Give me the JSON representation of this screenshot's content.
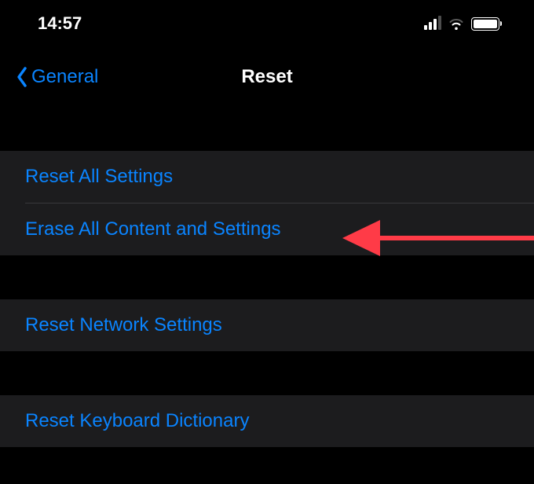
{
  "statusBar": {
    "time": "14:57"
  },
  "navBar": {
    "backLabel": "General",
    "title": "Reset"
  },
  "groups": [
    {
      "items": [
        {
          "label": "Reset All Settings"
        },
        {
          "label": "Erase All Content and Settings"
        }
      ]
    },
    {
      "items": [
        {
          "label": "Reset Network Settings"
        }
      ]
    },
    {
      "items": [
        {
          "label": "Reset Keyboard Dictionary"
        }
      ]
    }
  ],
  "colors": {
    "accent": "#0a84ff",
    "annotationArrow": "#ff3b47"
  }
}
